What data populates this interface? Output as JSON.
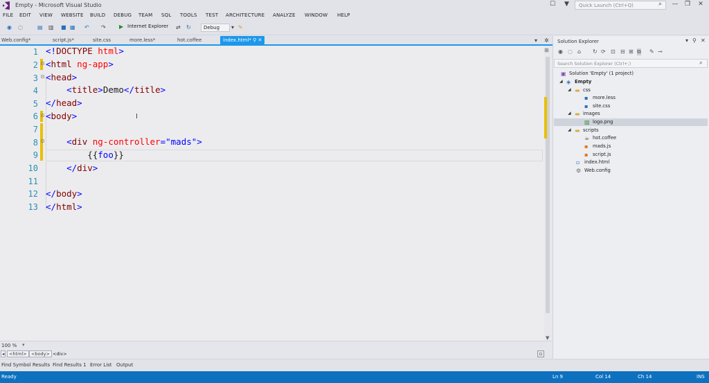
{
  "window": {
    "title": "Empty - Microsoft Visual Studio",
    "quick_launch_placeholder": "Quick Launch (Ctrl+Q)"
  },
  "menu": [
    "FILE",
    "EDIT",
    "VIEW",
    "WEBSITE",
    "BUILD",
    "DEBUG",
    "TEAM",
    "SQL",
    "TOOLS",
    "TEST",
    "ARCHITECTURE",
    "ANALYZE",
    "WINDOW",
    "HELP"
  ],
  "toolbar": {
    "browser": "Internet Explorer",
    "configuration": "Debug"
  },
  "tabs": [
    {
      "label": "Web.config*"
    },
    {
      "label": "script.js*"
    },
    {
      "label": "site.css"
    },
    {
      "label": "more.less*"
    },
    {
      "label": "hot.coffee"
    },
    {
      "label": "index.html*",
      "active": true
    }
  ],
  "editor": {
    "line_numbers": [
      "1",
      "2",
      "3",
      "4",
      "5",
      "6",
      "7",
      "8",
      "9",
      "10",
      "11",
      "12",
      "13"
    ],
    "current_line": 9,
    "zoom": "100 %"
  },
  "breadcrumb": [
    "<html>",
    "<body>",
    "<div>"
  ],
  "bottom_tabs": [
    "Find Symbol Results",
    "Find Results 1",
    "Error List",
    "Output"
  ],
  "status": {
    "state": "Ready",
    "line": "Ln 9",
    "col": "Col 14",
    "ch": "Ch 14",
    "mode": "INS"
  },
  "solution_explorer": {
    "title": "Solution Explorer",
    "search_placeholder": "Search Solution Explorer (Ctrl+;)",
    "items": [
      {
        "label": "Solution 'Empty' (1 project)"
      },
      {
        "label": "Empty"
      },
      {
        "label": "css"
      },
      {
        "label": "more.less"
      },
      {
        "label": "site.css"
      },
      {
        "label": "images"
      },
      {
        "label": "logo.png"
      },
      {
        "label": "scripts"
      },
      {
        "label": "hot.coffee"
      },
      {
        "label": "mads.js"
      },
      {
        "label": "script.js"
      },
      {
        "label": "index.html"
      },
      {
        "label": "Web.config"
      }
    ]
  },
  "colors": {
    "accent": "#1c97ea",
    "statusbar": "#0e71c0",
    "change_marker": "#e7c000",
    "tag": "#800000",
    "attribute": "#ff0000",
    "value": "#0000ff"
  }
}
